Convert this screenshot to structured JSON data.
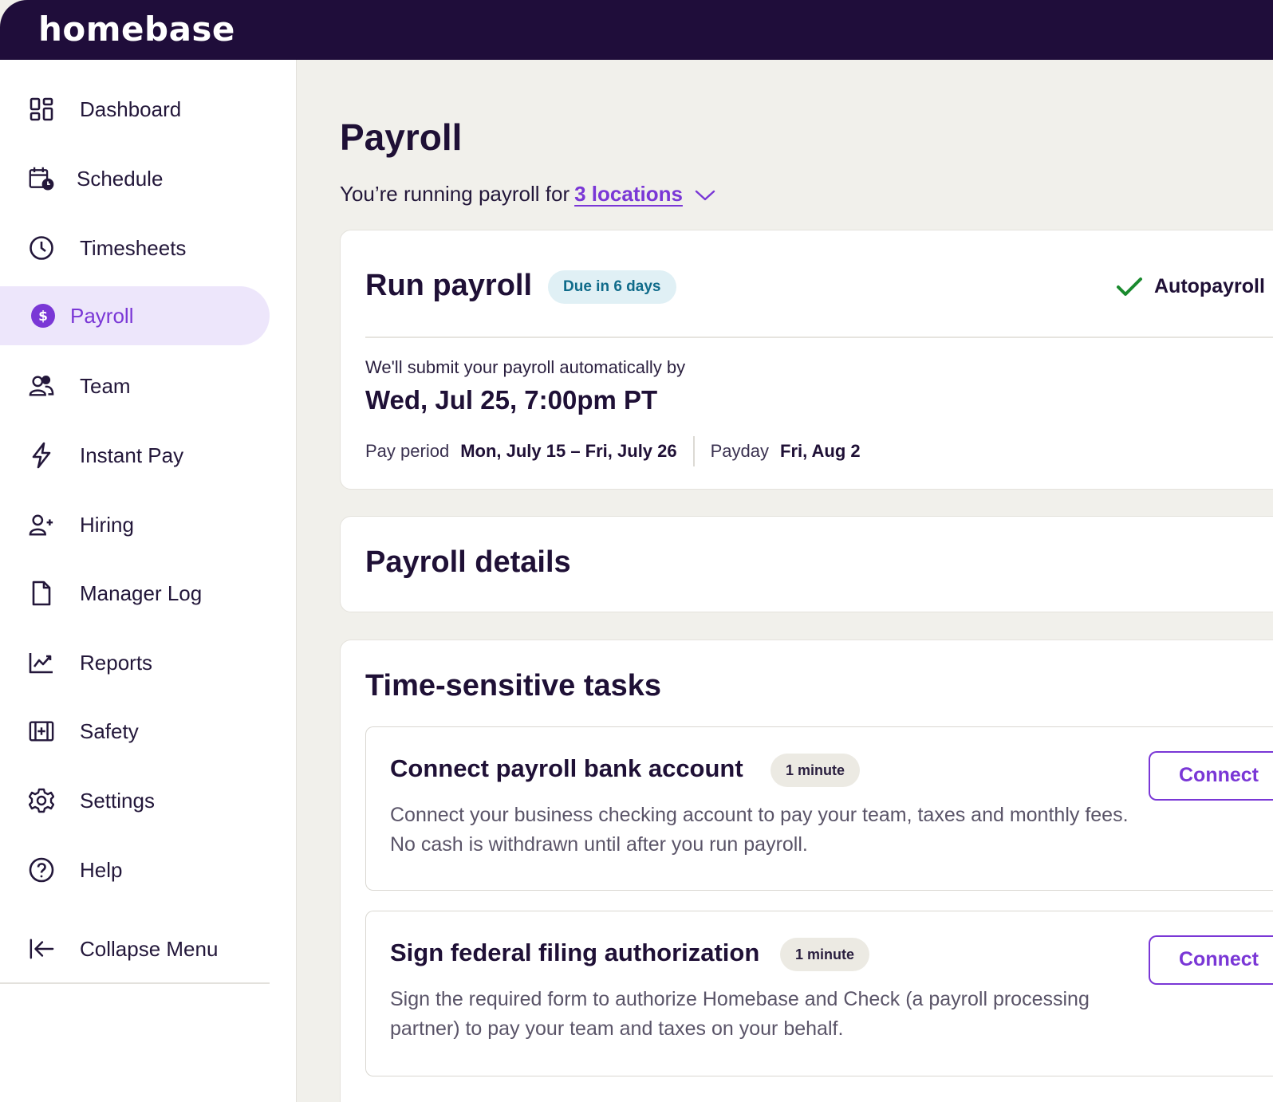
{
  "app": {
    "logo": "homebase"
  },
  "sidebar": {
    "items": [
      {
        "label": "Dashboard",
        "icon": "dashboard-icon"
      },
      {
        "label": "Schedule",
        "icon": "calendar-clock-icon"
      },
      {
        "label": "Timesheets",
        "icon": "clock-icon"
      },
      {
        "label": "Payroll",
        "icon": "dollar-icon",
        "active": true
      },
      {
        "label": "Team",
        "icon": "team-icon"
      },
      {
        "label": "Instant Pay",
        "icon": "lightning-icon"
      },
      {
        "label": "Hiring",
        "icon": "add-user-icon"
      },
      {
        "label": "Manager Log",
        "icon": "document-icon"
      },
      {
        "label": "Reports",
        "icon": "chart-icon"
      },
      {
        "label": "Safety",
        "icon": "first-aid-icon"
      },
      {
        "label": "Settings",
        "icon": "gear-icon"
      },
      {
        "label": "Help",
        "icon": "question-icon"
      }
    ],
    "collapse_label": "Collapse Menu"
  },
  "page": {
    "title": "Payroll",
    "subline_prefix": "You’re running payroll for",
    "locations_link": "3 locations"
  },
  "run_payroll": {
    "title": "Run payroll",
    "due_badge": "Due in 6 days",
    "autopay_label": "Autopayroll",
    "submit_note": "We'll submit your payroll automatically by",
    "submit_date": "Wed, Jul 25, 7:00pm PT",
    "pay_period_label": "Pay period",
    "pay_period_value": "Mon, July 15 – Fri, July 26",
    "payday_label": "Payday",
    "payday_value": "Fri, Aug 2"
  },
  "payroll_details": {
    "title": "Payroll details"
  },
  "tasks": {
    "title": "Time-sensitive tasks",
    "items": [
      {
        "title": "Connect payroll bank account",
        "badge": "1 minute",
        "description": "Connect your business checking account to pay your team, taxes and monthly fees. No cash is withdrawn until after you run payroll.",
        "button": "Connect"
      },
      {
        "title": "Sign federal filing authorization",
        "badge": "1 minute",
        "description": "Sign the required form to authorize Homebase and Check (a payroll processing partner) to pay your team and taxes on your behalf.",
        "button": "Connect"
      }
    ]
  },
  "colors": {
    "brand_dark": "#1f0d3a",
    "accent": "#7a37d6",
    "success": "#1a8a2e"
  }
}
